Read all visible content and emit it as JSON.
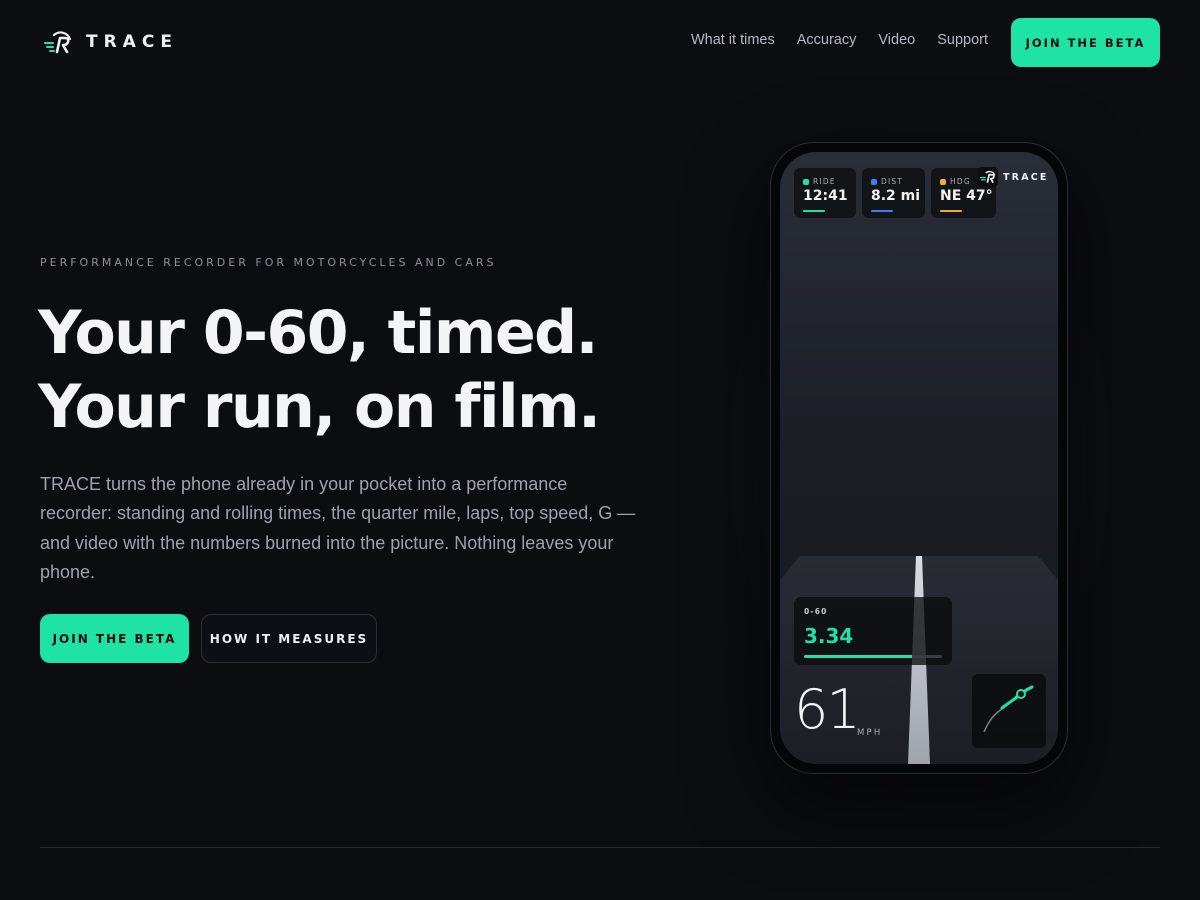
{
  "brand": {
    "name": "TRACE"
  },
  "nav": {
    "links": [
      "What it times",
      "Accuracy",
      "Video",
      "Support"
    ],
    "cta": "JOIN THE BETA"
  },
  "hero": {
    "eyebrow": "PERFORMANCE RECORDER FOR MOTORCYCLES AND CARS",
    "headline_line1": "Your 0-60, timed.",
    "headline_line2": "Your run, on film.",
    "lede": "TRACE turns the phone already in your pocket into a performance recorder: standing and rolling times, the quarter mile, laps, top speed, G — and video with the numbers burned into the picture. Nothing leaves your phone.",
    "primary_cta": "JOIN THE BETA",
    "secondary_cta": "HOW IT MEASURES"
  },
  "phone": {
    "brand": "TRACE",
    "stats": [
      {
        "label": "RIDE",
        "value": "12:41",
        "color": "#1ee3a4"
      },
      {
        "label": "DIST",
        "value": "8.2 mi",
        "color": "#3f7ef0"
      },
      {
        "label": "HDG",
        "value": "NE 47°",
        "color": "#f2a93b"
      }
    ],
    "split": {
      "label": "0-60",
      "value": "3.34",
      "progress": 0.78
    },
    "speed": {
      "value": "61",
      "unit": "MPH"
    }
  },
  "colors": {
    "accent": "#1ee3a4",
    "background": "#0c0d11",
    "ride": "#1ee3a4",
    "dist": "#3f7ef0",
    "hdg": "#f2a93b"
  }
}
